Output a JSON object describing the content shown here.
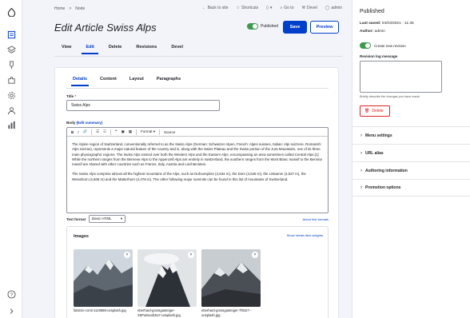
{
  "breadcrumb": [
    "Home",
    ">",
    "Node"
  ],
  "top_links": {
    "back": "Back to site",
    "shortcuts": "Shortcuts",
    "goto": "Go to",
    "devel": "Devel",
    "user": "admin"
  },
  "page": {
    "title": "Edit Article Swiss Alps",
    "published_label": "Published",
    "save_label": "Save",
    "preview_label": "Preview"
  },
  "tabs": [
    "View",
    "Edit",
    "Delete",
    "Revisions",
    "Devel"
  ],
  "subtabs": [
    "Details",
    "Content",
    "Layout",
    "Paragraphs"
  ],
  "form": {
    "title_label": "Title",
    "title_required": "*",
    "title_value": "Swiss Alps",
    "body_label": "Body",
    "body_link": "(Edit summary)",
    "toolbar": {
      "bold": "B",
      "italic": "I",
      "link": "🔗",
      "ul": "☰",
      "ol": "☷",
      "quote": "❞",
      "image": "▣",
      "table": "▦",
      "format": "Format",
      "format_chev": "▾",
      "source": "Source"
    },
    "body_p1": "The Alpine region of Switzerland, conventionally referred to as the Swiss Alps (German: Schweizer Alpen, French: Alpes suisses, Italian: Alpi svizzere, Romansh: Alps svizras), represents a major natural feature of the country and is, along with the Swiss Plateau and the Swiss portion of the Jura Mountains, one of its three main physiographic regions. The Swiss Alps extend over both the Western Alps and the Eastern Alps, encompassing an area sometimes called Central Alps.[1] While the northern ranges from the Bernese Alps to the Appenzell Alps are entirely in Switzerland, the southern ranges from the Mont Blanc massif to the Bernina massif are shared with other countries such as France, Italy, Austria and Liechtenstein.",
    "body_p2": "The Swiss Alps comprise almost all the highest mountains of the Alps, such as Dufourspitze (4,634 m), the Dom (4,545 m), the Liskamm (4,527 m), the Weisshorn (4,506 m) and the Matterhorn (4,478 m). The other following major summits can be found in this list of mountains of Switzerland.",
    "text_format_label": "Text format",
    "text_format_value": "Basic HTML",
    "text_format_link": "About text formats",
    "images_title": "Images",
    "images_link": "Show media item weights",
    "images": [
      {
        "caption": "fabrizio-conti-1119888-unsplash.jpg"
      },
      {
        "caption": "eberhard-grossgasteiger-X5Pu8xxxb3w7-unsplash.jpg"
      },
      {
        "caption": "eberhard-grossgasteiger-7f8427--unsplash.jpg"
      }
    ]
  },
  "sidebar": {
    "title": "Published",
    "last_saved_label": "Last saved:",
    "last_saved_value": "04/03/2021 - 11:35",
    "author_label": "Author:",
    "author_value": "admin",
    "new_revision_label": "Create new revision",
    "log_label": "Revision log message",
    "log_help": "Briefly describe the changes you have made.",
    "delete_label": "Delete",
    "sections": [
      "Menu settings",
      "URL alias",
      "Authoring information",
      "Promotion options"
    ]
  },
  "colors": {
    "primary": "#003ecc",
    "success": "#3f9a4f",
    "danger": "#dc2323"
  }
}
